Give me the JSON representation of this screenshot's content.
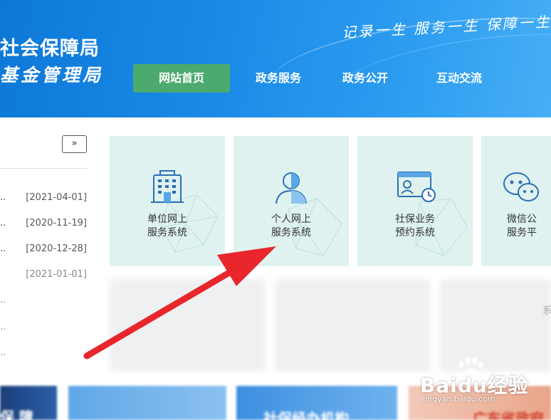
{
  "header": {
    "org_line1": "社会保障局",
    "org_line2": "基金管理局",
    "slogan": "记录一生 服务一生 保障一生"
  },
  "nav": [
    {
      "label": "网站首页",
      "active": true
    },
    {
      "label": "政务服务"
    },
    {
      "label": "政务公开"
    },
    {
      "label": "互动交流"
    }
  ],
  "news": {
    "more_label": "»",
    "items": [
      {
        "date": "[2021-04-01]"
      },
      {
        "date": "[2020-11-19]"
      },
      {
        "date": "[2020-12-28]"
      },
      {
        "date": "[2021-01-01]"
      }
    ]
  },
  "cards": [
    {
      "line1": "单位网上",
      "line2": "服务系统",
      "icon": "building-icon"
    },
    {
      "line1": "个人网上",
      "line2": "服务系统",
      "icon": "person-icon"
    },
    {
      "line1": "社保业务",
      "line2": "预约系统",
      "icon": "id-card-clock-icon"
    },
    {
      "line1": "微信公",
      "line2": "服务平",
      "icon": "wechat-icon"
    }
  ],
  "lower_partial_text": "系",
  "banners": {
    "left": "保 障",
    "middle": "社保经办机构",
    "right": "广东省政府"
  },
  "watermark": {
    "logo": "Baidu经验",
    "sub": "jingyan.baidu.com"
  },
  "colors": {
    "header_blue": "#1a8ae6",
    "nav_active": "#4caa6e",
    "card_bg": "#dff2ef",
    "icon_blue": "#2a6fb7",
    "arrow_red": "#e8262b"
  }
}
